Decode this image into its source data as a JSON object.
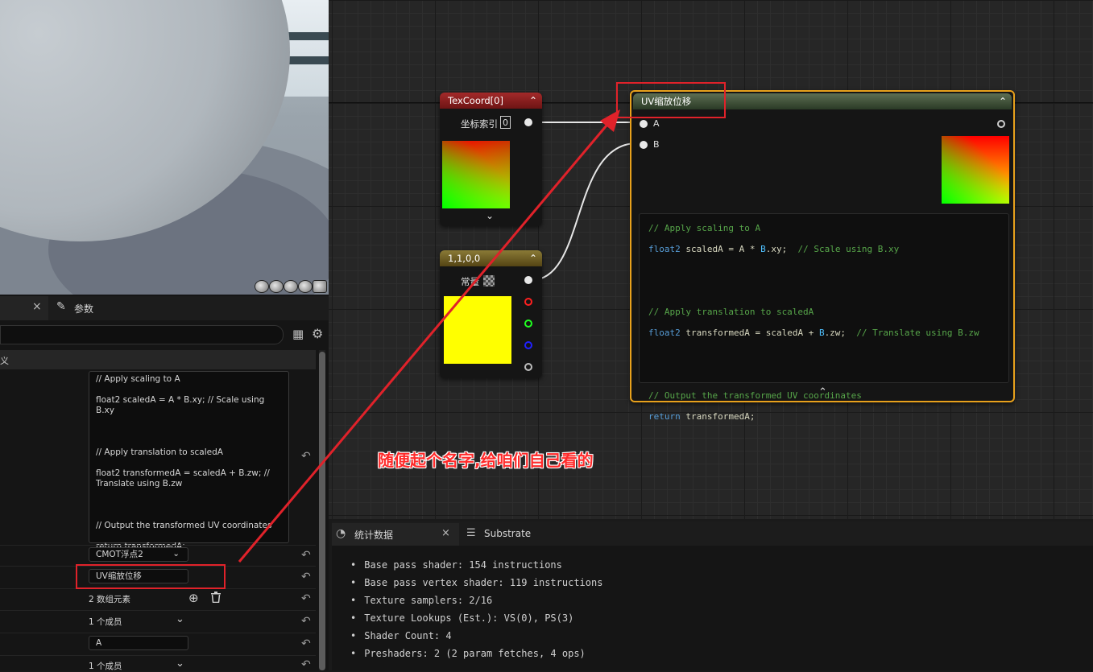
{
  "left_panel": {
    "details_tab_close": "×",
    "params_tab": "参数",
    "section_header": "义",
    "code_lines": [
      "// Apply scaling to A",
      "",
      "float2 scaledA = A * B.xy;  // Scale using B.xy",
      "",
      "",
      "",
      "// Apply translation to scaledA",
      "",
      "float2 transformedA = scaledA + B.zw;  //",
      "Translate using B.zw",
      "",
      "",
      "",
      "// Output the transformed UV coordinates",
      "",
      "return transformedA;"
    ],
    "output_type": "CMOT浮点2",
    "description": "UV缩放位移",
    "array_elements": "2 数组元素",
    "member_1": "1 个成员",
    "input_name": "A",
    "member_2": "1 个成员"
  },
  "nodes": {
    "texcoord": {
      "title": "TexCoord[0]",
      "index_label": "坐标索引",
      "index_value": "0"
    },
    "constant": {
      "title": "1,1,0,0",
      "label": "常量"
    },
    "custom": {
      "title": "UV缩放位移",
      "input_a": "A",
      "input_b": "B",
      "code": [
        {
          "comment": "// Apply scaling to A"
        },
        {
          "type": "float2",
          "rest": " scaledA = A * ",
          "var": "B",
          "rest2": ".xy;",
          "comment": "  // Scale using B.xy"
        },
        {},
        {},
        {
          "comment": "// Apply translation to scaledA"
        },
        {
          "type": "float2",
          "rest": " transformedA = scaledA + ",
          "var": "B",
          "rest2": ".zw;",
          "comment": "  // Translate using B.zw"
        },
        {},
        {},
        {
          "comment": "// Output the transformed UV coordinates"
        },
        {
          "type": "return",
          "rest": " transformedA;"
        }
      ]
    }
  },
  "annotation": "随便起个名字,给咱们自己看的",
  "stats": {
    "tab_stats": "统计数据",
    "tab_stats_close": "×",
    "tab_substrate": "Substrate",
    "lines": [
      "Base pass shader: 154 instructions",
      "Base pass vertex shader: 119 instructions",
      "Texture samplers: 2/16",
      "Texture Lookups (Est.): VS(0), PS(3)",
      "Shader Count: 4",
      "Preshaders: 2  (2 param fetches, 4 ops)"
    ]
  },
  "colors": {
    "annotation_red": "#e0222a",
    "selected_node_border": "#e8a11c",
    "code_comment": "#57a64a",
    "code_keyword": "#569cd6",
    "code_var": "#4fc1ff"
  }
}
